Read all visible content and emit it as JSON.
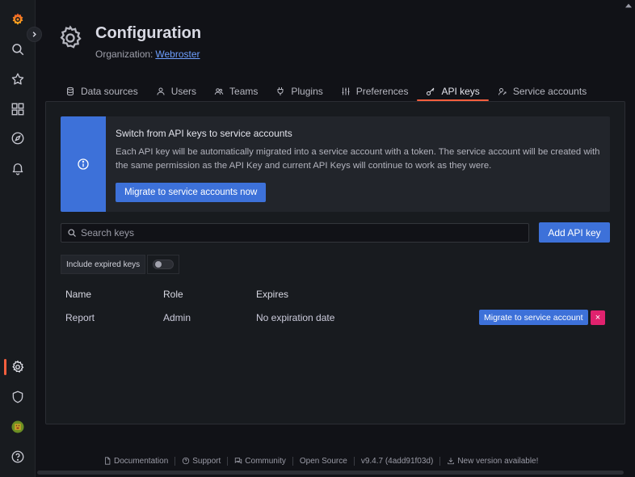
{
  "sidebar": {
    "icons": [
      "grafana-logo",
      "search-icon",
      "starred-icon",
      "dashboards-icon",
      "explore-icon",
      "alerting-icon",
      "configuration-icon",
      "server-admin-icon",
      "user-avatar",
      "help-icon"
    ]
  },
  "header": {
    "title": "Configuration",
    "org_label": "Organization:",
    "org_name": "Webroster"
  },
  "tabs": [
    {
      "label": "Data sources",
      "icon": "database-icon"
    },
    {
      "label": "Users",
      "icon": "user-icon"
    },
    {
      "label": "Teams",
      "icon": "users-icon"
    },
    {
      "label": "Plugins",
      "icon": "plug-icon"
    },
    {
      "label": "Preferences",
      "icon": "sliders-icon"
    },
    {
      "label": "API keys",
      "icon": "key-icon",
      "active": true
    },
    {
      "label": "Service accounts",
      "icon": "gf-service-account-icon"
    }
  ],
  "alert": {
    "title": "Switch from API keys to service accounts",
    "body": "Each API key will be automatically migrated into a service account with a token. The service account will be created with the same permission as the API Key and current API Keys will continue to work as they were.",
    "button": "Migrate to service accounts now"
  },
  "search": {
    "placeholder": "Search keys",
    "value": ""
  },
  "add_button": "Add API key",
  "include_expired": {
    "label": "Include expired keys",
    "enabled": false
  },
  "table": {
    "columns": [
      "Name",
      "Role",
      "Expires"
    ],
    "rows": [
      {
        "name": "Report",
        "role": "Admin",
        "expires": "No expiration date",
        "migrate_label": "Migrate to service account",
        "delete_label": "×"
      }
    ]
  },
  "footer": [
    {
      "label": "Documentation",
      "icon": "document-icon"
    },
    {
      "label": "Support",
      "icon": "question-icon"
    },
    {
      "label": "Community",
      "icon": "comments-icon"
    },
    {
      "label": "Open Source",
      "icon": ""
    },
    {
      "label": "v9.4.7 (4add91f03d)",
      "icon": ""
    },
    {
      "label": "New version available!",
      "icon": "download-icon"
    }
  ],
  "colors": {
    "accent": "#f55f3e",
    "primary": "#3d71d9",
    "danger": "#e0226e",
    "background": "#111217",
    "panel": "#181b1f"
  }
}
